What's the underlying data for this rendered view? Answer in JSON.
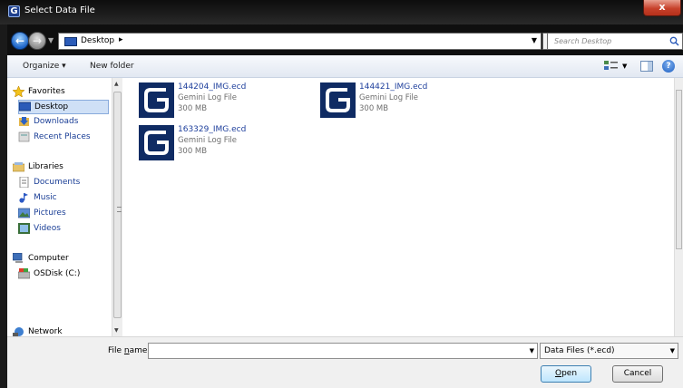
{
  "window": {
    "title": "Select Data File",
    "close_glyph": "x",
    "app_icon": "G"
  },
  "address_bar": {
    "location": "Desktop",
    "search_placeholder": "Search Desktop"
  },
  "toolbar": {
    "organize_label": "Organize ▾",
    "new_folder_label": "New folder"
  },
  "sidebar": {
    "items": [
      {
        "label": "Favorites",
        "icon": "star-icon"
      },
      {
        "label": "Desktop",
        "icon": "desktop-icon",
        "selected": true
      },
      {
        "label": "Downloads",
        "icon": "downloads-icon"
      },
      {
        "label": "Recent Places",
        "icon": "recent-places-icon"
      },
      {
        "label": "Libraries",
        "icon": "libraries-icon"
      },
      {
        "label": "Documents",
        "icon": "documents-icon"
      },
      {
        "label": "Music",
        "icon": "music-icon"
      },
      {
        "label": "Pictures",
        "icon": "pictures-icon"
      },
      {
        "label": "Videos",
        "icon": "videos-icon"
      },
      {
        "label": "Computer",
        "icon": "computer-icon"
      },
      {
        "label": "OSDisk (C:)",
        "icon": "disk-icon"
      },
      {
        "label": "Network",
        "icon": "network-icon"
      }
    ]
  },
  "files": [
    {
      "name": "144204_IMG.ecd",
      "type": "Gemini Log File",
      "size": "300 MB"
    },
    {
      "name": "144421_IMG.ecd",
      "type": "Gemini Log File",
      "size": "300 MB"
    },
    {
      "name": "163329_IMG.ecd",
      "type": "Gemini Log File",
      "size": "300 MB"
    }
  ],
  "bottom": {
    "file_name_label_pre": "File ",
    "file_name_label_ul": "n",
    "file_name_label_post": "ame:",
    "file_name_value": "",
    "filter_value": "Data Files (*.ecd)",
    "open_ul": "O",
    "open_rest": "pen",
    "cancel_label": "Cancel"
  },
  "colors": {
    "link": "#1a3e96",
    "file_icon_bg": "#0f2b63",
    "selection": "#cfe0f6"
  }
}
